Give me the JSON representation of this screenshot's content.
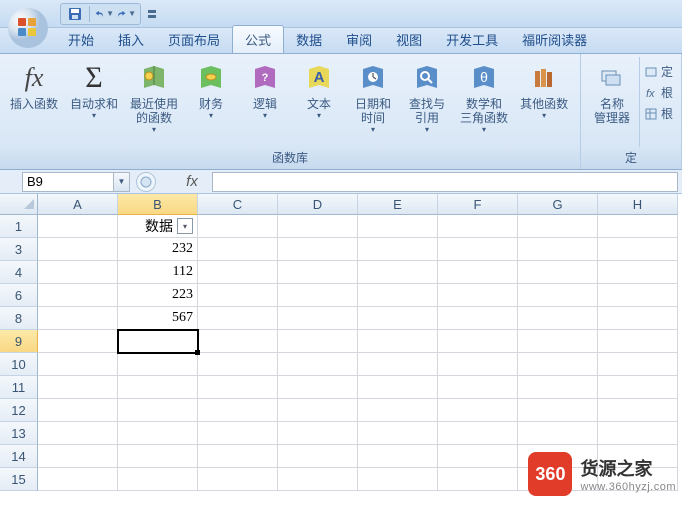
{
  "qat": {
    "save": "save",
    "undo": "undo",
    "redo": "redo"
  },
  "tabs": {
    "home": "开始",
    "insert": "插入",
    "layout": "页面布局",
    "formula": "公式",
    "data": "数据",
    "review": "审阅",
    "view": "视图",
    "developer": "开发工具",
    "foxit": "福昕阅读器"
  },
  "ribbon": {
    "insert_fn": "插入函数",
    "autosum": "自动求和",
    "recent": "最近使用\n的函数",
    "financial": "财务",
    "logical": "逻辑",
    "text": "文本",
    "datetime": "日期和\n时间",
    "lookup": "查找与\n引用",
    "math": "数学和\n三角函数",
    "other": "其他函数",
    "name_mgr": "名称\n管理器",
    "group_lib": "函数库",
    "group_names": "定",
    "side1": "定",
    "side2": "根",
    "side3": "根"
  },
  "namebox": "B9",
  "fx": "fx",
  "columns": [
    "A",
    "B",
    "C",
    "D",
    "E",
    "F",
    "G",
    "H"
  ],
  "rows": [
    {
      "n": "1",
      "b": "数据",
      "filter": true
    },
    {
      "n": "3",
      "b": "232"
    },
    {
      "n": "4",
      "b": "112"
    },
    {
      "n": "6",
      "b": "223"
    },
    {
      "n": "8",
      "b": "567"
    },
    {
      "n": "9",
      "sel": true
    },
    {
      "n": "10"
    },
    {
      "n": "11"
    },
    {
      "n": "12"
    },
    {
      "n": "13"
    },
    {
      "n": "14"
    },
    {
      "n": "15"
    }
  ],
  "watermark": {
    "badge": "360",
    "title": "货源之家",
    "url": "www.360hyzj.com"
  }
}
